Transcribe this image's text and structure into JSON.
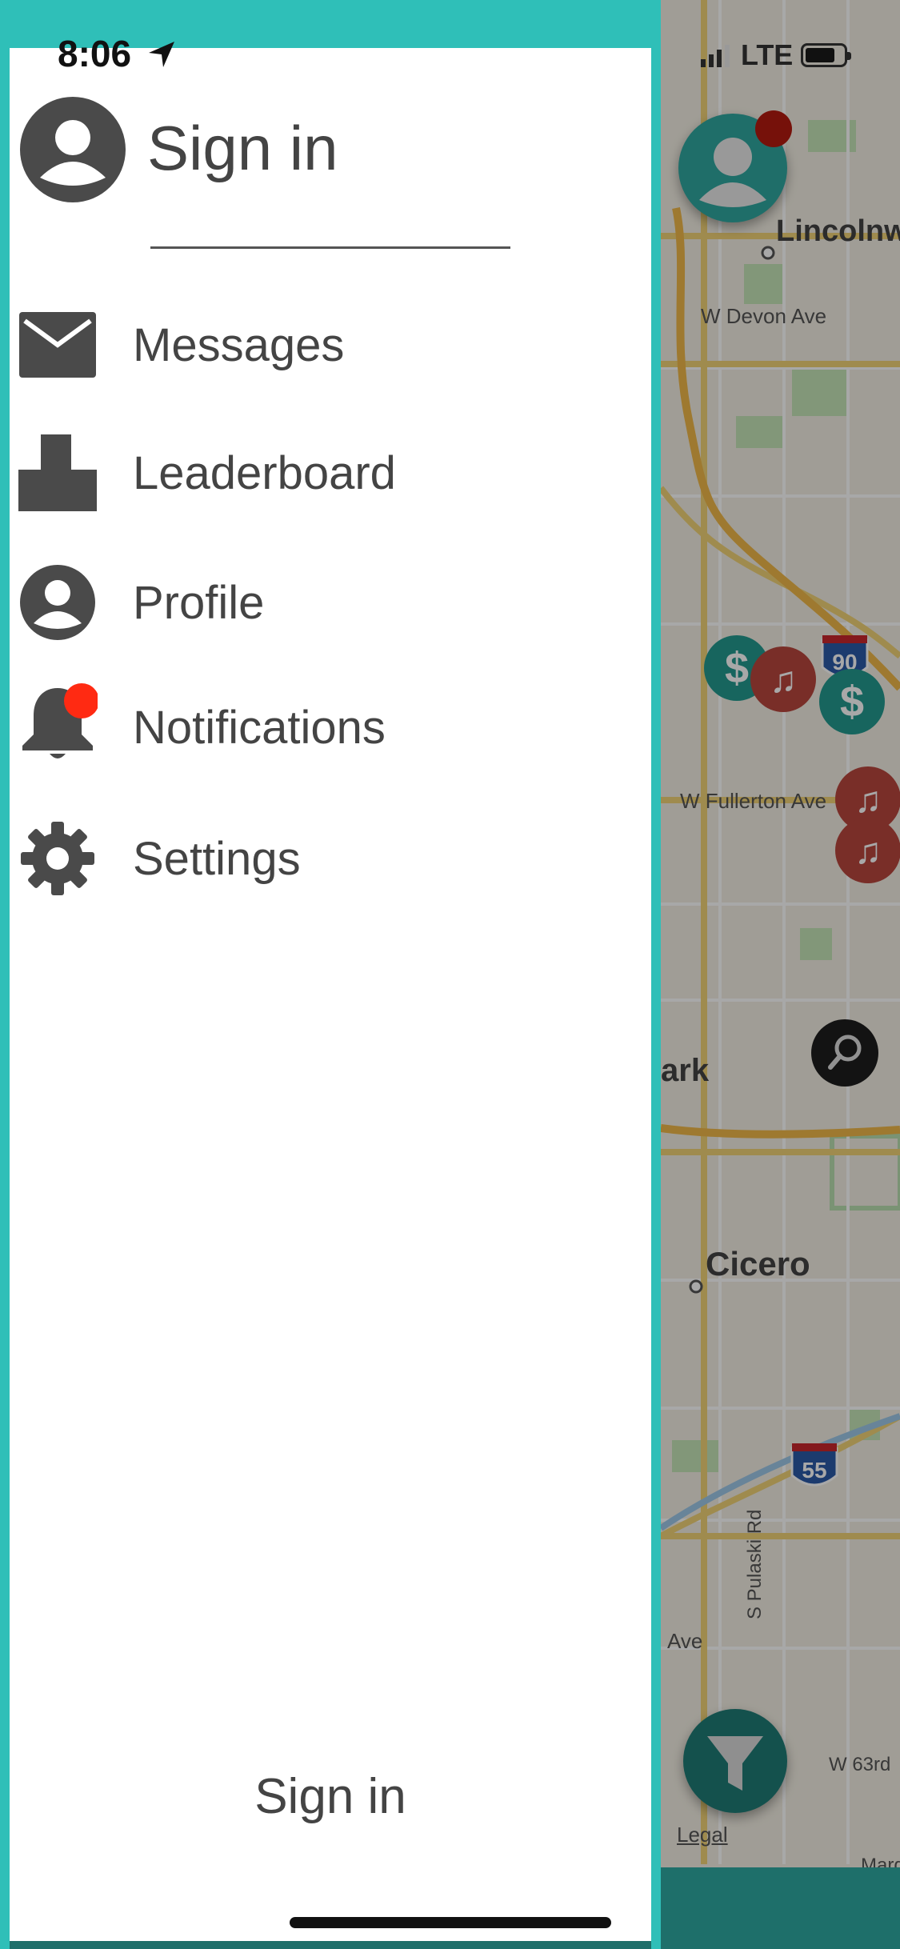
{
  "status_bar": {
    "time": "8:06",
    "network": "LTE"
  },
  "drawer": {
    "header_title": "Sign in",
    "menu": [
      {
        "label": "Messages",
        "icon": "envelope-icon"
      },
      {
        "label": "Leaderboard",
        "icon": "leaderboard-icon"
      },
      {
        "label": "Profile",
        "icon": "profile-icon"
      },
      {
        "label": "Notifications",
        "icon": "bell-icon",
        "badge": true
      },
      {
        "label": "Settings",
        "icon": "gear-icon"
      }
    ],
    "footer_button": "Sign in"
  },
  "map": {
    "labels": [
      "Lincolnw",
      "W Devon Ave",
      "W Fullerton Ave",
      "ark",
      "Cicero",
      "S Pulaski Rd",
      "Ave",
      "W 63rd",
      "Legal",
      "Marqu"
    ],
    "highway_shields": [
      "90",
      "55"
    ]
  },
  "colors": {
    "accent": "#2fbfb8",
    "icon_gray": "#4a4a4a",
    "badge_red": "#ff2a12",
    "pin_money": "#239a8f",
    "pin_music": "#b8463e"
  }
}
